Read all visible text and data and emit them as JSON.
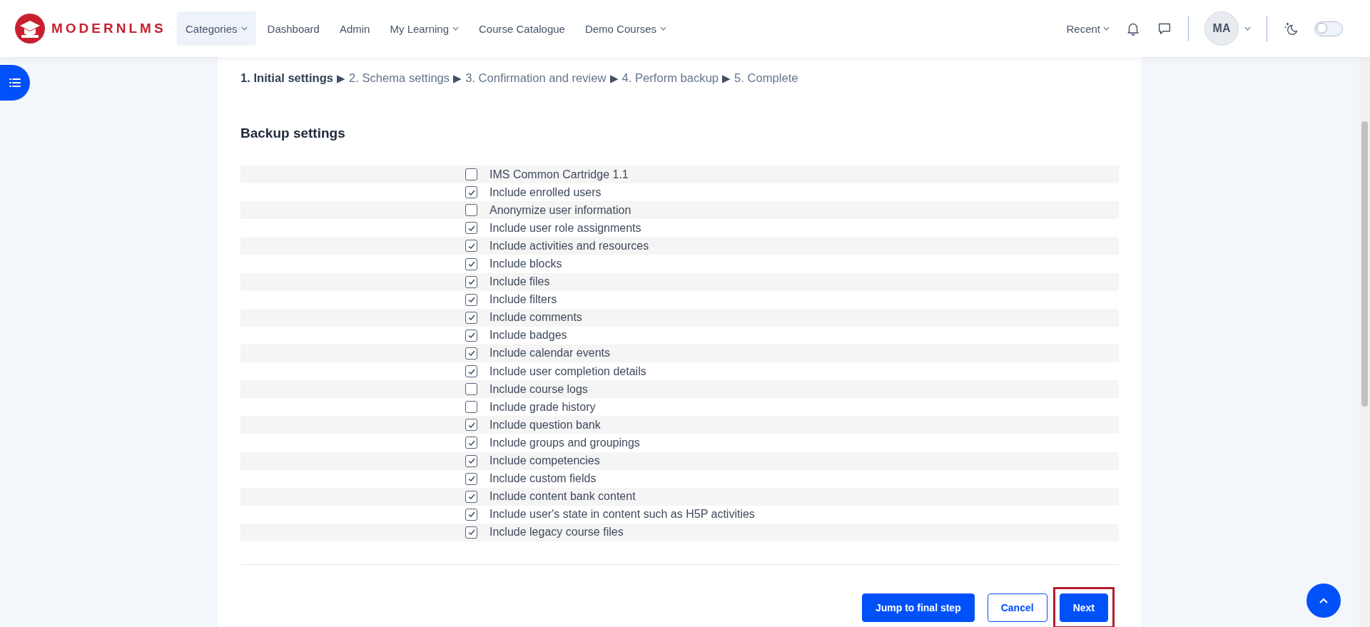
{
  "header": {
    "logo": "MODERNLMS",
    "nav": [
      {
        "label": "Categories",
        "caret": true,
        "selected": true
      },
      {
        "label": "Dashboard",
        "caret": false,
        "selected": false
      },
      {
        "label": "Admin",
        "caret": false,
        "selected": false
      },
      {
        "label": "My Learning",
        "caret": true,
        "selected": false
      },
      {
        "label": "Course Catalogue",
        "caret": false,
        "selected": false
      },
      {
        "label": "Demo Courses",
        "caret": true,
        "selected": false
      }
    ],
    "recent": "Recent",
    "avatar": "MA",
    "dark_mode": {
      "on": false
    }
  },
  "breadcrumb": [
    {
      "label": "1. Initial settings",
      "current": true
    },
    {
      "separator": "▶",
      "label": "2. Schema settings",
      "current": false
    },
    {
      "separator": "▶",
      "label": "3. Confirmation and review",
      "current": false
    },
    {
      "separator": "▶",
      "label": "4. Perform backup",
      "current": false
    },
    {
      "separator": "▶",
      "label": "5. Complete",
      "current": false
    }
  ],
  "section_title": "Backup settings",
  "settings": [
    {
      "label": "IMS Common Cartridge 1.1",
      "checked": false
    },
    {
      "label": "Include enrolled users",
      "checked": true
    },
    {
      "label": "Anonymize user information",
      "checked": false
    },
    {
      "label": "Include user role assignments",
      "checked": true
    },
    {
      "label": "Include activities and resources",
      "checked": true
    },
    {
      "label": "Include blocks",
      "checked": true
    },
    {
      "label": "Include files",
      "checked": true
    },
    {
      "label": "Include filters",
      "checked": true
    },
    {
      "label": "Include comments",
      "checked": true
    },
    {
      "label": "Include badges",
      "checked": true
    },
    {
      "label": "Include calendar events",
      "checked": true
    },
    {
      "label": "Include user completion details",
      "checked": true
    },
    {
      "label": "Include course logs",
      "checked": false
    },
    {
      "label": "Include grade history",
      "checked": false
    },
    {
      "label": "Include question bank",
      "checked": true
    },
    {
      "label": "Include groups and groupings",
      "checked": true
    },
    {
      "label": "Include competencies",
      "checked": true
    },
    {
      "label": "Include custom fields",
      "checked": true
    },
    {
      "label": "Include content bank content",
      "checked": true
    },
    {
      "label": "Include user's state in content such as H5P activities",
      "checked": true
    },
    {
      "label": "Include legacy course files",
      "checked": true
    }
  ],
  "buttons": [
    {
      "label": "Jump to final step",
      "kind": "primary",
      "highlighted": false
    },
    {
      "label": "Cancel",
      "kind": "outline",
      "highlighted": false
    },
    {
      "label": "Next",
      "kind": "primary",
      "highlighted": true
    }
  ]
}
